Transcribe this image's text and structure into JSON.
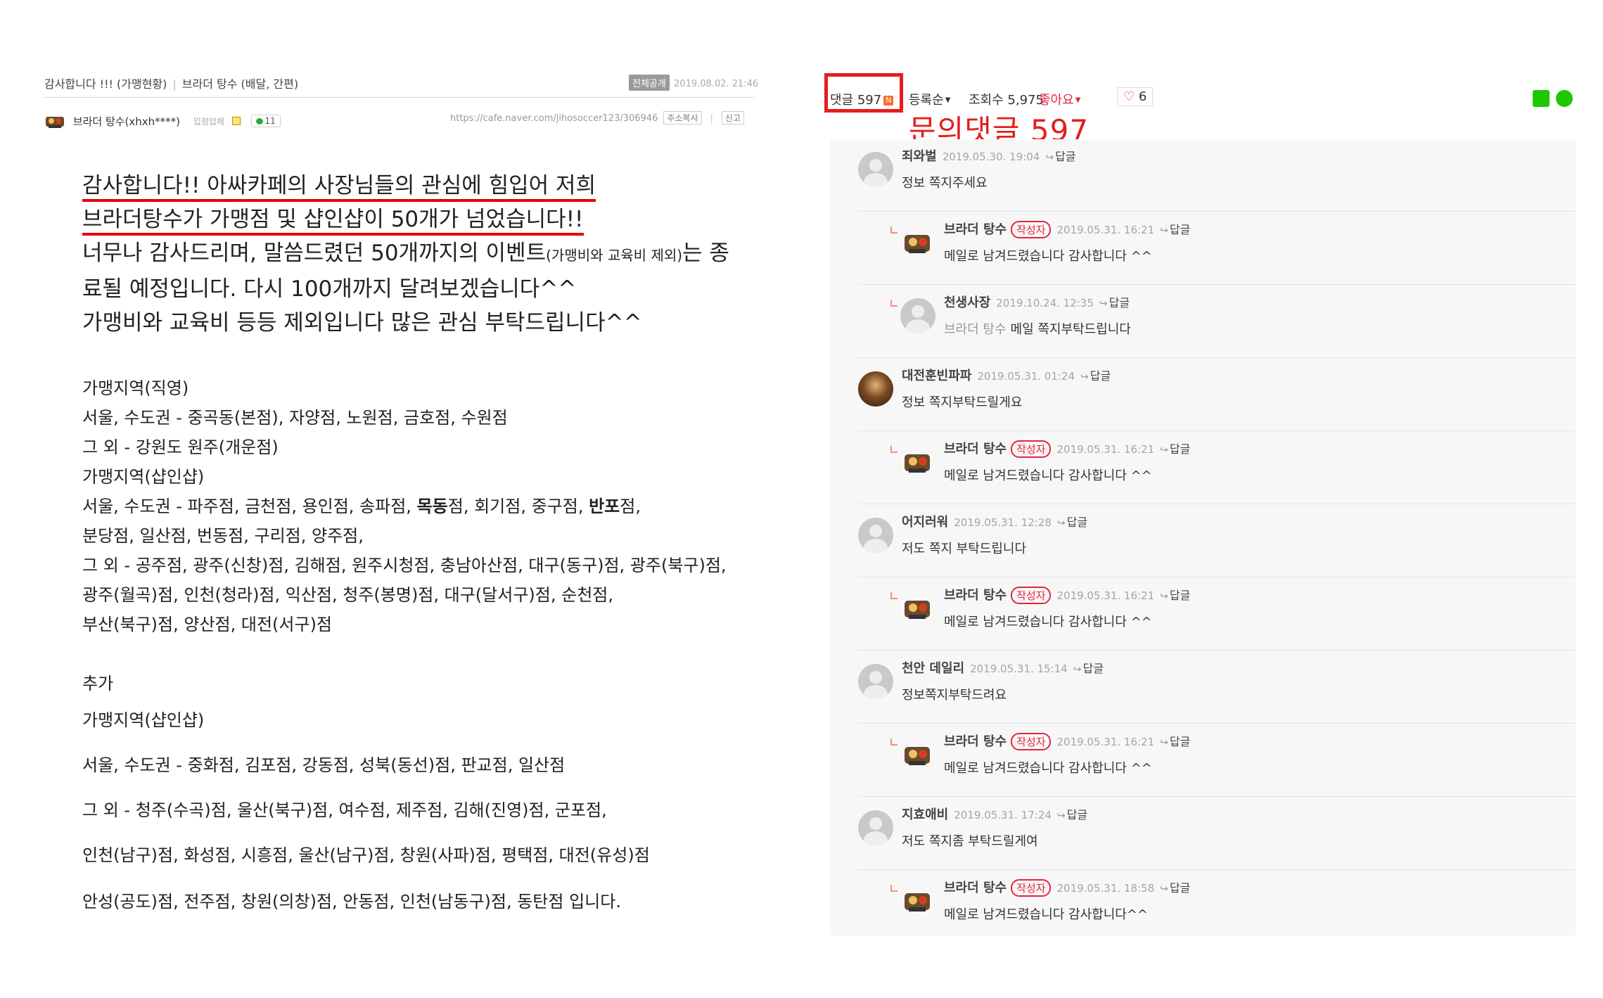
{
  "post": {
    "breadcrumb_title": "감사합니다 !!! (가맹현황)",
    "breadcrumb_board": "브라더 탕수 (배달, 간편)",
    "visibility_badge": "전체공개",
    "date": "2019.08.02. 21:46",
    "author_name": "브라더 탕수(xhxh****)",
    "author_role": "입점업체",
    "comment_count_badge": "11",
    "url": "https://cafe.naver.com/jihosoccer123/306946",
    "copy_url_label": "주소복사",
    "report_label": "신고",
    "intro_line1": "감사합니다!! 아싸카페의 사장님들의 관심에 힘입어 저희",
    "intro_line2": "브라더탕수가 가맹점 및 샵인샵이 50개가 넘었습니다!!",
    "intro_line3a": "너무나 감사드리며, 말씀드렸던 50개까지의 이벤트",
    "intro_line3b": "(가맹비와 교육비 제외)",
    "intro_line3c": "는 종",
    "intro_line4": "료될 예정입니다. 다시 100개까지 달려보겠습니다^^",
    "intro_line5": "가맹비와 교육비 등등 제외입니다 많은 관심 부탁드립니다^^",
    "s1_title": "가맹지역(직영)",
    "s1_line1": "서울, 수도권 - 중곡동(본점), 자양점, 노원점, 금호점, 수원점",
    "s1_line2": "그 외 - 강원도 원주(개운점)",
    "s2_title": "가맹지역(샵인샵)",
    "s2_line1a": "서울, 수도권 - 파주점, 금천점, 용인점, 송파점, ",
    "s2_line1b": "목동",
    "s2_line1c": "점, 회기점, 중구점, ",
    "s2_line1d": "반포",
    "s2_line1e": "점,",
    "s2_line2": "분당점, 일산점, 번동점, 구리점, 양주점,",
    "s2_line3": "그 외 - 공주점, 광주(신창)점, 김해점, 원주시청점, 충남아산점, 대구(동구)점, 광주(북구)점,",
    "s2_line4": "광주(월곡)점, 인천(청라)점, 익산점, 청주(봉명)점, 대구(달서구)점, 순천점,",
    "s2_line5": "부산(북구)점, 양산점, 대전(서구)점",
    "s3_title": "추가",
    "s3_subtitle": "가맹지역(샵인샵)",
    "s3_line1": "서울, 수도권 - 중화점, 김포점, 강동점, 성북(동선)점, 판교점, 일산점",
    "s3_line2": "그 외 - 청주(수곡)점, 울산(북구)점, 여수점, 제주점, 김해(진영)점, 군포점,",
    "s3_line3": "인천(남구)점, 화성점, 시흥점, 울산(남구)점, 창원(사파)점, 평택점, 대전(유성)점",
    "s3_line4": "안성(공도)점, 전주점, 창원(의창)점, 안동점, 인천(남동구)점, 동탄점 입니다."
  },
  "comments_header": {
    "comment_label": "댓글 597",
    "new_badge": "N",
    "sort_label": "등록순",
    "views_label": "조회수 5,975",
    "like_label": "좋아요",
    "heart_count": "6",
    "annotation": "문의댓글 597"
  },
  "comments": [
    {
      "name": "죄와벌",
      "date": "2019.05.30. 19:04",
      "reply": "답글",
      "text": "정보 쪽지주세요"
    },
    {
      "name": "브라더 탕수",
      "badge": "작성자",
      "date": "2019.05.31. 16:21",
      "reply": "답글",
      "text": "메일로 남겨드렸습니다 감사합니다 ^^"
    },
    {
      "name": "천생사장",
      "date": "2019.10.24. 12:35",
      "reply": "답글",
      "mention": "브라더 탕수",
      "text": "메일 쪽지부탁드립니다"
    },
    {
      "name": "대전훈빈파파",
      "date": "2019.05.31. 01:24",
      "reply": "답글",
      "text": "정보 쪽지부탁드릴게요"
    },
    {
      "name": "브라더 탕수",
      "badge": "작성자",
      "date": "2019.05.31. 16:21",
      "reply": "답글",
      "text": "메일로 남겨드렸습니다 감사합니다 ^^"
    },
    {
      "name": "어지러워",
      "date": "2019.05.31. 12:28",
      "reply": "답글",
      "text": "저도 쪽지 부탁드립니다"
    },
    {
      "name": "브라더 탕수",
      "badge": "작성자",
      "date": "2019.05.31. 16:21",
      "reply": "답글",
      "text": "메일로 남겨드렸습니다 감사합니다 ^^"
    },
    {
      "name": "천안 데일리",
      "date": "2019.05.31. 15:14",
      "reply": "답글",
      "text": "정보쪽지부탁드려요"
    },
    {
      "name": "브라더 탕수",
      "badge": "작성자",
      "date": "2019.05.31. 16:21",
      "reply": "답글",
      "text": "메일로 남겨드렸습니다 감사합니다 ^^"
    },
    {
      "name": "지효애비",
      "date": "2019.05.31. 17:24",
      "reply": "답글",
      "text": "저도 쪽지좀 부탁드릴게여"
    },
    {
      "name": "브라더 탕수",
      "badge": "작성자",
      "date": "2019.05.31. 18:58",
      "reply": "답글",
      "text": "메일로 남겨드렸습니다 감사합니다^^"
    }
  ],
  "colors": {
    "accent_red": "#e5253d",
    "annotation_red": "#e51e1e",
    "naver_green": "#1ec800"
  }
}
